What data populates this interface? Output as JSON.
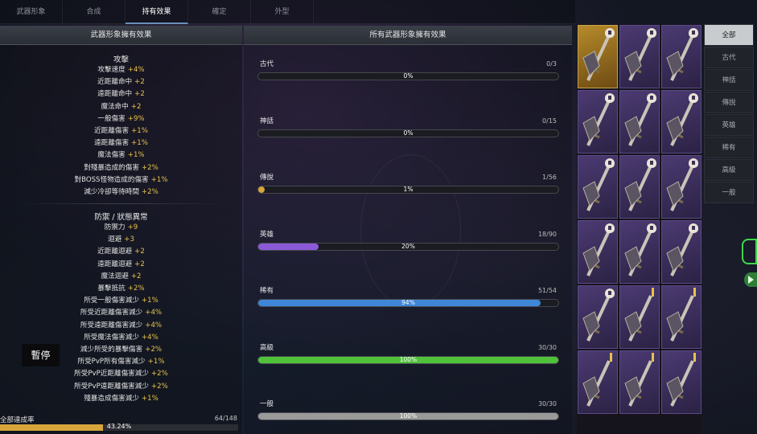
{
  "top_tabs": [
    "武器形象",
    "合成",
    "持有效果",
    "確定",
    "外型"
  ],
  "active_tab_index": 2,
  "left_panel": {
    "title": "武器形象擁有效果",
    "attack_title": "攻擊",
    "attack_stats": [
      {
        "name": "攻擊速度",
        "value": "+4%"
      },
      {
        "name": "近距離命中",
        "value": "+2"
      },
      {
        "name": "遠距離命中",
        "value": "+2"
      },
      {
        "name": "魔法命中",
        "value": "+2"
      },
      {
        "name": "一般傷害",
        "value": "+9%"
      },
      {
        "name": "近距離傷害",
        "value": "+1%"
      },
      {
        "name": "遠距離傷害",
        "value": "+1%"
      },
      {
        "name": "魔法傷害",
        "value": "+1%"
      },
      {
        "name": "對殘暴造成的傷害",
        "value": "+2%"
      },
      {
        "name": "對BOSS怪物造成的傷害",
        "value": "+1%"
      },
      {
        "name": "減少冷卻等待時間",
        "value": "+2%"
      }
    ],
    "defense_title": "防禦 / 狀態異常",
    "defense_stats": [
      {
        "name": "防禦力",
        "value": "+9"
      },
      {
        "name": "迴避",
        "value": "+3"
      },
      {
        "name": "近距離迴避",
        "value": "+2"
      },
      {
        "name": "遠距離迴避",
        "value": "+2"
      },
      {
        "name": "魔法迴避",
        "value": "+2"
      },
      {
        "name": "暴擊抵抗",
        "value": "+2%"
      },
      {
        "name": "所受一般傷害減少",
        "value": "+1%"
      },
      {
        "name": "所受近距離傷害減少",
        "value": "+4%"
      },
      {
        "name": "所受遠距離傷害減少",
        "value": "+4%"
      },
      {
        "name": "所受魔法傷害減少",
        "value": "+4%"
      },
      {
        "name": "減少所受的暴擊傷害",
        "value": "+2%"
      },
      {
        "name": "所受PvP所有傷害減少",
        "value": "+1%"
      },
      {
        "name": "所受PvP近距離傷害減少",
        "value": "+2%"
      },
      {
        "name": "所受PvP遠距離傷害減少",
        "value": "+2%"
      },
      {
        "name": "殘暴造成傷害減少",
        "value": "+1%"
      }
    ],
    "pause_label": "暫停",
    "total": {
      "label": "全部達成率",
      "count": "64/148",
      "percent_text": "43.24%",
      "percent": 43.24
    }
  },
  "middle_panel": {
    "title": "所有武器形象擁有效果",
    "grades": [
      {
        "name": "古代",
        "count": "0/3",
        "percent_text": "0%",
        "percent": 0,
        "color": "#8a8a8a"
      },
      {
        "name": "神話",
        "count": "0/15",
        "percent_text": "0%",
        "percent": 0,
        "color": "#8a8a8a"
      },
      {
        "name": "傳說",
        "count": "1/56",
        "percent_text": "1%",
        "percent": 1,
        "color": "#d8a53c"
      },
      {
        "name": "英雄",
        "count": "18/90",
        "percent_text": "20%",
        "percent": 20,
        "color": "#8b5ad8"
      },
      {
        "name": "稀有",
        "count": "51/54",
        "percent_text": "94%",
        "percent": 94,
        "color": "#3f86d8"
      },
      {
        "name": "高級",
        "count": "30/30",
        "percent_text": "100%",
        "percent": 100,
        "color": "#4fc23a"
      },
      {
        "name": "一般",
        "count": "30/30",
        "percent_text": "100%",
        "percent": 100,
        "color": "#9a9a9a"
      }
    ]
  },
  "weapon_grid": {
    "cells": [
      {
        "icon": "shield-weapon-icon",
        "tier": "legendary",
        "badge": "shield"
      },
      {
        "icon": "sword-icon",
        "tier": "heroic",
        "badge": "shield"
      },
      {
        "icon": "spear-shield-icon",
        "tier": "heroic",
        "badge": "shield"
      },
      {
        "icon": "dagger-shield-icon",
        "tier": "heroic",
        "badge": "shield"
      },
      {
        "icon": "axe-shield-icon",
        "tier": "heroic",
        "badge": "shield"
      },
      {
        "icon": "sword-shield-icon",
        "tier": "heroic",
        "badge": "shield"
      },
      {
        "icon": "sword-shield-icon",
        "tier": "heroic",
        "badge": "shield"
      },
      {
        "icon": "sword-shield-icon",
        "tier": "heroic",
        "badge": "shield"
      },
      {
        "icon": "sword-shield-icon",
        "tier": "heroic",
        "badge": "shield"
      },
      {
        "icon": "shield-axe-icon",
        "tier": "heroic",
        "badge": "shield"
      },
      {
        "icon": "sword-shield-icon",
        "tier": "heroic",
        "badge": "shield"
      },
      {
        "icon": "shield-icon",
        "tier": "heroic",
        "badge": "shield"
      },
      {
        "icon": "battle-axe-icon",
        "tier": "heroic",
        "badge": "shield"
      },
      {
        "icon": "sword-icon",
        "tier": "heroic",
        "badge": "mark"
      },
      {
        "icon": "axe-icon",
        "tier": "heroic",
        "badge": "mark"
      },
      {
        "icon": "dagger-icon",
        "tier": "heroic",
        "badge": "mark"
      },
      {
        "icon": "scimitar-icon",
        "tier": "heroic",
        "badge": "mark"
      },
      {
        "icon": "hammer-icon",
        "tier": "heroic",
        "badge": "mark"
      }
    ]
  },
  "filters": [
    "全部",
    "古代",
    "神話",
    "傳說",
    "英雄",
    "稀有",
    "高級",
    "一般"
  ],
  "active_filter_index": 0
}
